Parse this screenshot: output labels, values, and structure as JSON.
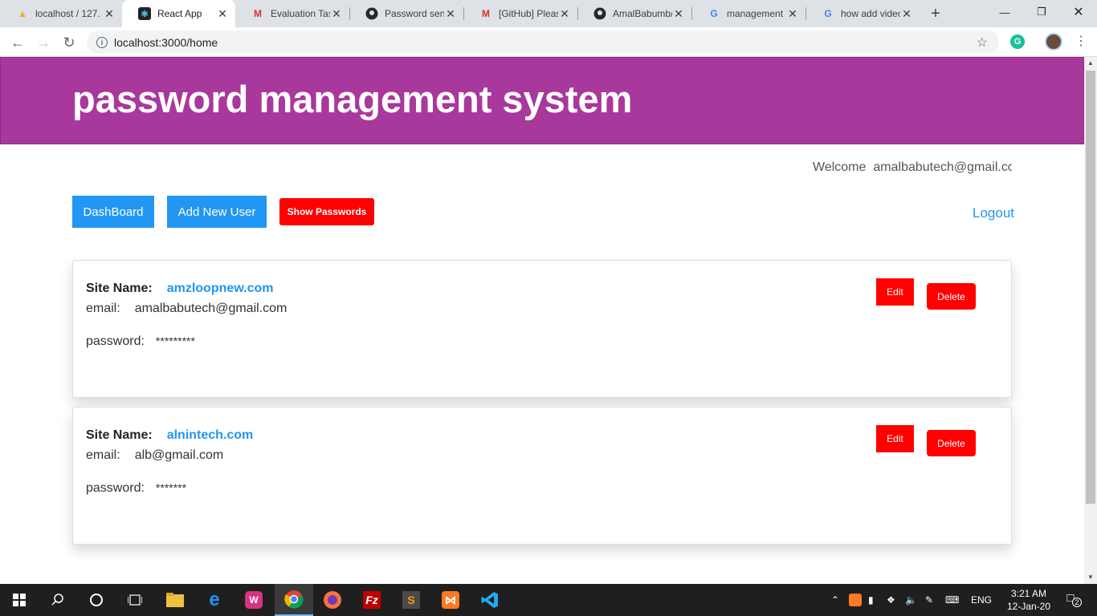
{
  "browser": {
    "tabs": [
      {
        "title": "localhost / 127.",
        "icon": "phpmyadmin-icon"
      },
      {
        "title": "React App",
        "icon": "react-icon",
        "active": true
      },
      {
        "title": "Evaluation Task",
        "icon": "gmail-icon"
      },
      {
        "title": "Password sent",
        "icon": "github-icon"
      },
      {
        "title": "[GitHub] Please",
        "icon": "gmail-icon"
      },
      {
        "title": "AmalBabumb/",
        "icon": "github-icon"
      },
      {
        "title": "management -",
        "icon": "google-icon"
      },
      {
        "title": "how add video",
        "icon": "google-icon"
      }
    ],
    "url": "localhost:3000/home"
  },
  "header": {
    "title": "password management system"
  },
  "welcome": {
    "label": "Welcome",
    "email": "amalbabutech@gmail.com"
  },
  "nav": {
    "dashboard": "DashBoard",
    "add_user": "Add New User",
    "show_passwords": "Show Passwords",
    "logout": "Logout"
  },
  "entries": [
    {
      "site_label": "Site Name:",
      "site": "amzloopnew.com",
      "email_label": "email:",
      "email": "amalbabutech@gmail.com",
      "password_label": "password:",
      "password": "*********",
      "edit": "Edit",
      "delete": "Delete"
    },
    {
      "site_label": "Site Name:",
      "site": "alnintech.com",
      "email_label": "email:",
      "email": "alb@gmail.com",
      "password_label": "password:",
      "password": "*******",
      "edit": "Edit",
      "delete": "Delete"
    }
  ],
  "taskbar": {
    "apps": [
      "windows-start-icon",
      "search-icon",
      "cortana-icon",
      "task-view-icon",
      "file-explorer-icon",
      "edge-icon",
      "wamp-icon",
      "chrome-icon",
      "firefox-icon",
      "filezilla-icon",
      "sublime-icon",
      "xampp-icon",
      "vscode-icon"
    ],
    "lang": "ENG",
    "time": "3:21 AM",
    "date": "12-Jan-20",
    "notifications": "2"
  },
  "colors": {
    "header": "#a8389c",
    "primary": "#2196f3",
    "danger": "#ff0000"
  }
}
